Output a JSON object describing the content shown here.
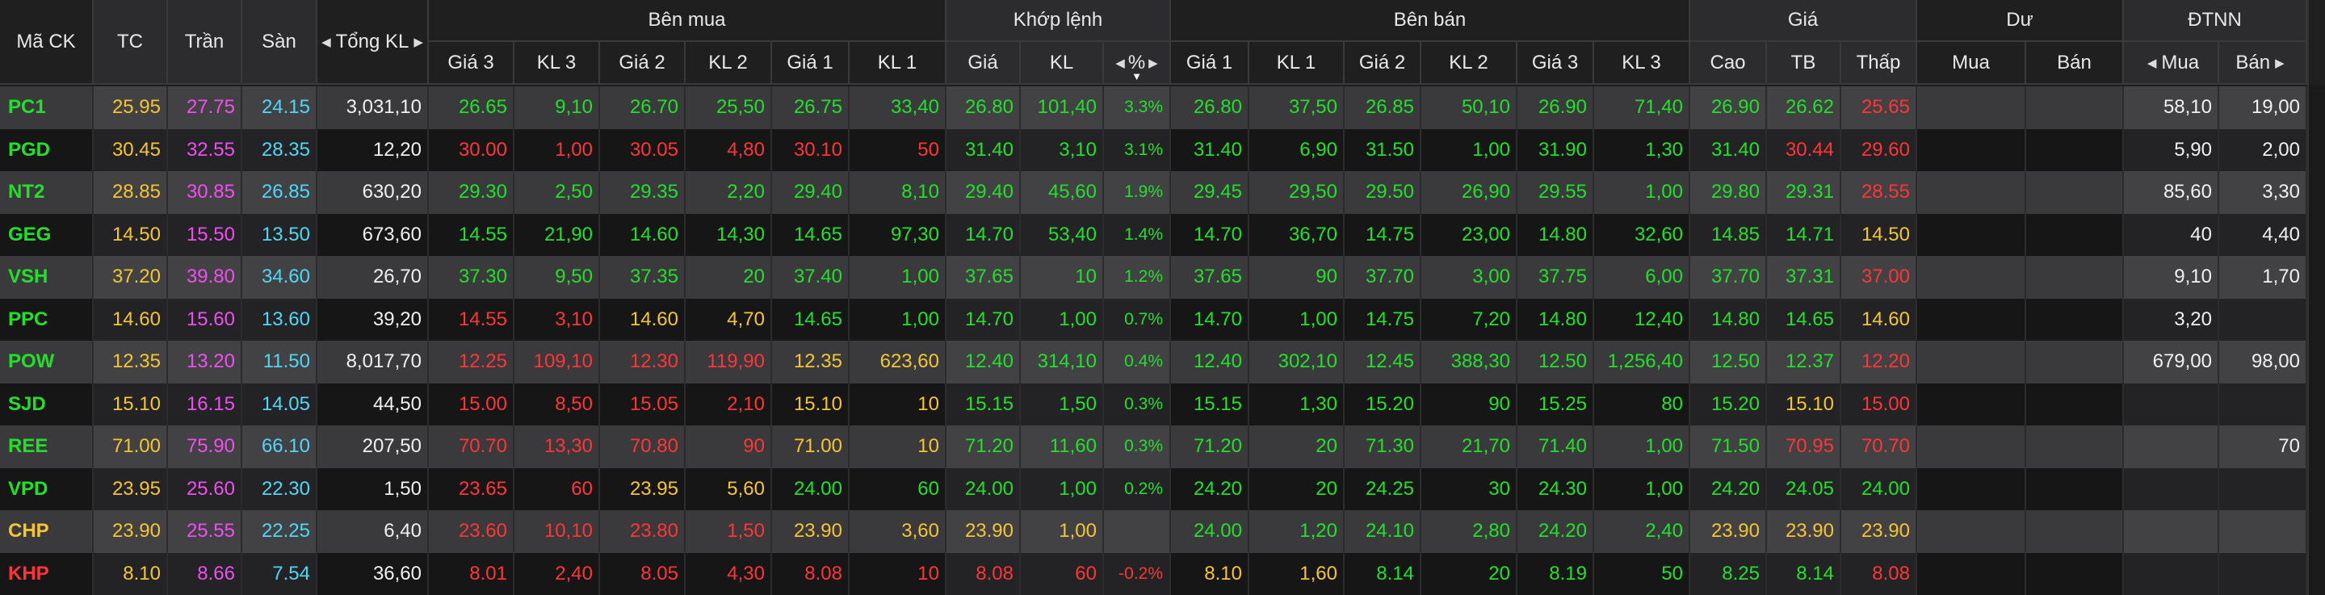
{
  "colors": {
    "header_bg": "#1f1f1f",
    "row_odd_bg": "#3a3a3c",
    "row_even_bg": "#161616",
    "group_bg": "#2f2f31",
    "col_group_bg": "#2c2c2e",
    "up": "#22e02a",
    "down": "#ff3535",
    "ref": "#f5c531",
    "ceiling": "#f04ef0",
    "floor": "#4fd8f5",
    "text": "#f0f0f0"
  },
  "header": {
    "symbol": "Mã CK",
    "ref": "TC",
    "ceiling": "Trần",
    "floor": "Sàn",
    "total_volume": "Tổng KL",
    "buy_group": "Bên mua",
    "match_group": "Khớp lệnh",
    "sell_group": "Bên bán",
    "price_group": "Giá",
    "remain_group": "Dư",
    "foreign_group": "ĐTNN",
    "buy_cols": [
      "Giá 3",
      "KL 3",
      "Giá 2",
      "KL 2",
      "Giá 1",
      "KL 1"
    ],
    "match_cols": [
      "Giá",
      "KL",
      "%"
    ],
    "sell_cols": [
      "Giá 1",
      "KL 1",
      "Giá 2",
      "KL 2",
      "Giá 3",
      "KL 3"
    ],
    "price_cols": [
      "Cao",
      "TB",
      "Thấp"
    ],
    "remain_cols": [
      "Mua",
      "Bán"
    ],
    "foreign_cols": [
      "Mua",
      "Bán"
    ]
  },
  "rows": [
    {
      "cells": [
        "PC1",
        "25.95",
        "27.75",
        "24.15",
        "3,031,10",
        "26.65",
        "9,10",
        "26.70",
        "25,50",
        "26.75",
        "33,40",
        "26.80",
        "101,40",
        "3.3%",
        "26.80",
        "37,50",
        "26.85",
        "50,10",
        "26.90",
        "71,40",
        "26.90",
        "26.62",
        "25.65",
        "",
        "",
        "58,10",
        "19,00"
      ],
      "colors": [
        "green",
        "yellow",
        "ceil",
        "floor",
        "white",
        "green",
        "green",
        "green",
        "green",
        "green",
        "green",
        "green",
        "green",
        "green",
        "green",
        "green",
        "green",
        "green",
        "green",
        "green",
        "green",
        "green",
        "red",
        "white",
        "white",
        "white",
        "white"
      ]
    },
    {
      "cells": [
        "PGD",
        "30.45",
        "32.55",
        "28.35",
        "12,20",
        "30.00",
        "1,00",
        "30.05",
        "4,80",
        "30.10",
        "50",
        "31.40",
        "3,10",
        "3.1%",
        "31.40",
        "6,90",
        "31.50",
        "1,00",
        "31.90",
        "1,30",
        "31.40",
        "30.44",
        "29.60",
        "",
        "",
        "5,90",
        "2,00"
      ],
      "colors": [
        "green",
        "yellow",
        "ceil",
        "floor",
        "white",
        "red",
        "red",
        "red",
        "red",
        "red",
        "red",
        "green",
        "green",
        "green",
        "green",
        "green",
        "green",
        "green",
        "green",
        "green",
        "green",
        "red",
        "red",
        "white",
        "white",
        "white",
        "white"
      ]
    },
    {
      "cells": [
        "NT2",
        "28.85",
        "30.85",
        "26.85",
        "630,20",
        "29.30",
        "2,50",
        "29.35",
        "2,20",
        "29.40",
        "8,10",
        "29.40",
        "45,60",
        "1.9%",
        "29.45",
        "29,50",
        "29.50",
        "26,90",
        "29.55",
        "1,00",
        "29.80",
        "29.31",
        "28.55",
        "",
        "",
        "85,60",
        "3,30"
      ],
      "colors": [
        "green",
        "yellow",
        "ceil",
        "floor",
        "white",
        "green",
        "green",
        "green",
        "green",
        "green",
        "green",
        "green",
        "green",
        "green",
        "green",
        "green",
        "green",
        "green",
        "green",
        "green",
        "green",
        "green",
        "red",
        "white",
        "white",
        "white",
        "white"
      ]
    },
    {
      "cells": [
        "GEG",
        "14.50",
        "15.50",
        "13.50",
        "673,60",
        "14.55",
        "21,90",
        "14.60",
        "14,30",
        "14.65",
        "97,30",
        "14.70",
        "53,40",
        "1.4%",
        "14.70",
        "36,70",
        "14.75",
        "23,00",
        "14.80",
        "32,60",
        "14.85",
        "14.71",
        "14.50",
        "",
        "",
        "40",
        "4,40"
      ],
      "colors": [
        "green",
        "yellow",
        "ceil",
        "floor",
        "white",
        "green",
        "green",
        "green",
        "green",
        "green",
        "green",
        "green",
        "green",
        "green",
        "green",
        "green",
        "green",
        "green",
        "green",
        "green",
        "green",
        "green",
        "yellow",
        "white",
        "white",
        "white",
        "white"
      ]
    },
    {
      "cells": [
        "VSH",
        "37.20",
        "39.80",
        "34.60",
        "26,70",
        "37.30",
        "9,50",
        "37.35",
        "20",
        "37.40",
        "1,00",
        "37.65",
        "10",
        "1.2%",
        "37.65",
        "90",
        "37.70",
        "3,00",
        "37.75",
        "6,00",
        "37.70",
        "37.31",
        "37.00",
        "",
        "",
        "9,10",
        "1,70"
      ],
      "colors": [
        "green",
        "yellow",
        "ceil",
        "floor",
        "white",
        "green",
        "green",
        "green",
        "green",
        "green",
        "green",
        "green",
        "green",
        "green",
        "green",
        "green",
        "green",
        "green",
        "green",
        "green",
        "green",
        "green",
        "red",
        "white",
        "white",
        "white",
        "white"
      ]
    },
    {
      "cells": [
        "PPC",
        "14.60",
        "15.60",
        "13.60",
        "39,20",
        "14.55",
        "3,10",
        "14.60",
        "4,70",
        "14.65",
        "1,00",
        "14.70",
        "1,00",
        "0.7%",
        "14.70",
        "1,00",
        "14.75",
        "7,20",
        "14.80",
        "12,40",
        "14.80",
        "14.65",
        "14.60",
        "",
        "",
        "3,20",
        ""
      ],
      "colors": [
        "green",
        "yellow",
        "ceil",
        "floor",
        "white",
        "red",
        "red",
        "yellow",
        "yellow",
        "green",
        "green",
        "green",
        "green",
        "green",
        "green",
        "green",
        "green",
        "green",
        "green",
        "green",
        "green",
        "green",
        "yellow",
        "white",
        "white",
        "white",
        "white"
      ]
    },
    {
      "cells": [
        "POW",
        "12.35",
        "13.20",
        "11.50",
        "8,017,70",
        "12.25",
        "109,10",
        "12.30",
        "119,90",
        "12.35",
        "623,60",
        "12.40",
        "314,10",
        "0.4%",
        "12.40",
        "302,10",
        "12.45",
        "388,30",
        "12.50",
        "1,256,40",
        "12.50",
        "12.37",
        "12.20",
        "",
        "",
        "679,00",
        "98,00"
      ],
      "colors": [
        "green",
        "yellow",
        "ceil",
        "floor",
        "white",
        "red",
        "red",
        "red",
        "red",
        "yellow",
        "yellow",
        "green",
        "green",
        "green",
        "green",
        "green",
        "green",
        "green",
        "green",
        "green",
        "green",
        "green",
        "red",
        "white",
        "white",
        "white",
        "white"
      ]
    },
    {
      "cells": [
        "SJD",
        "15.10",
        "16.15",
        "14.05",
        "44,50",
        "15.00",
        "8,50",
        "15.05",
        "2,10",
        "15.10",
        "10",
        "15.15",
        "1,50",
        "0.3%",
        "15.15",
        "1,30",
        "15.20",
        "90",
        "15.25",
        "80",
        "15.20",
        "15.10",
        "15.00",
        "",
        "",
        "",
        ""
      ],
      "colors": [
        "green",
        "yellow",
        "ceil",
        "floor",
        "white",
        "red",
        "red",
        "red",
        "red",
        "yellow",
        "yellow",
        "green",
        "green",
        "green",
        "green",
        "green",
        "green",
        "green",
        "green",
        "green",
        "green",
        "yellow",
        "red",
        "white",
        "white",
        "white",
        "white"
      ]
    },
    {
      "cells": [
        "REE",
        "71.00",
        "75.90",
        "66.10",
        "207,50",
        "70.70",
        "13,30",
        "70.80",
        "90",
        "71.00",
        "10",
        "71.20",
        "11,60",
        "0.3%",
        "71.20",
        "20",
        "71.30",
        "21,70",
        "71.40",
        "1,00",
        "71.50",
        "70.95",
        "70.70",
        "",
        "",
        "",
        "70"
      ],
      "colors": [
        "green",
        "yellow",
        "ceil",
        "floor",
        "white",
        "red",
        "red",
        "red",
        "red",
        "yellow",
        "yellow",
        "green",
        "green",
        "green",
        "green",
        "green",
        "green",
        "green",
        "green",
        "green",
        "green",
        "red",
        "red",
        "white",
        "white",
        "white",
        "white"
      ]
    },
    {
      "cells": [
        "VPD",
        "23.95",
        "25.60",
        "22.30",
        "1,50",
        "23.65",
        "60",
        "23.95",
        "5,60",
        "24.00",
        "60",
        "24.00",
        "1,00",
        "0.2%",
        "24.20",
        "20",
        "24.25",
        "30",
        "24.30",
        "1,00",
        "24.20",
        "24.05",
        "24.00",
        "",
        "",
        "",
        ""
      ],
      "colors": [
        "green",
        "yellow",
        "ceil",
        "floor",
        "white",
        "red",
        "red",
        "yellow",
        "yellow",
        "green",
        "green",
        "green",
        "green",
        "green",
        "green",
        "green",
        "green",
        "green",
        "green",
        "green",
        "green",
        "green",
        "green",
        "white",
        "white",
        "white",
        "white"
      ]
    },
    {
      "cells": [
        "CHP",
        "23.90",
        "25.55",
        "22.25",
        "6,40",
        "23.60",
        "10,10",
        "23.80",
        "1,50",
        "23.90",
        "3,60",
        "23.90",
        "1,00",
        "",
        "24.00",
        "1,20",
        "24.10",
        "2,80",
        "24.20",
        "2,40",
        "23.90",
        "23.90",
        "23.90",
        "",
        "",
        "",
        ""
      ],
      "colors": [
        "yellow",
        "yellow",
        "ceil",
        "floor",
        "white",
        "red",
        "red",
        "red",
        "red",
        "yellow",
        "yellow",
        "yellow",
        "yellow",
        "yellow",
        "green",
        "green",
        "green",
        "green",
        "green",
        "green",
        "yellow",
        "yellow",
        "yellow",
        "white",
        "white",
        "white",
        "white"
      ]
    },
    {
      "cells": [
        "KHP",
        "8.10",
        "8.66",
        "7.54",
        "36,60",
        "8.01",
        "2,40",
        "8.05",
        "4,30",
        "8.08",
        "10",
        "8.08",
        "60",
        "-0.2%",
        "8.10",
        "1,60",
        "8.14",
        "20",
        "8.19",
        "50",
        "8.25",
        "8.14",
        "8.08",
        "",
        "",
        "",
        ""
      ],
      "colors": [
        "red",
        "yellow",
        "ceil",
        "floor",
        "white",
        "red",
        "red",
        "red",
        "red",
        "red",
        "red",
        "red",
        "red",
        "red",
        "yellow",
        "yellow",
        "green",
        "green",
        "green",
        "green",
        "green",
        "green",
        "red",
        "white",
        "white",
        "white",
        "white"
      ]
    }
  ]
}
